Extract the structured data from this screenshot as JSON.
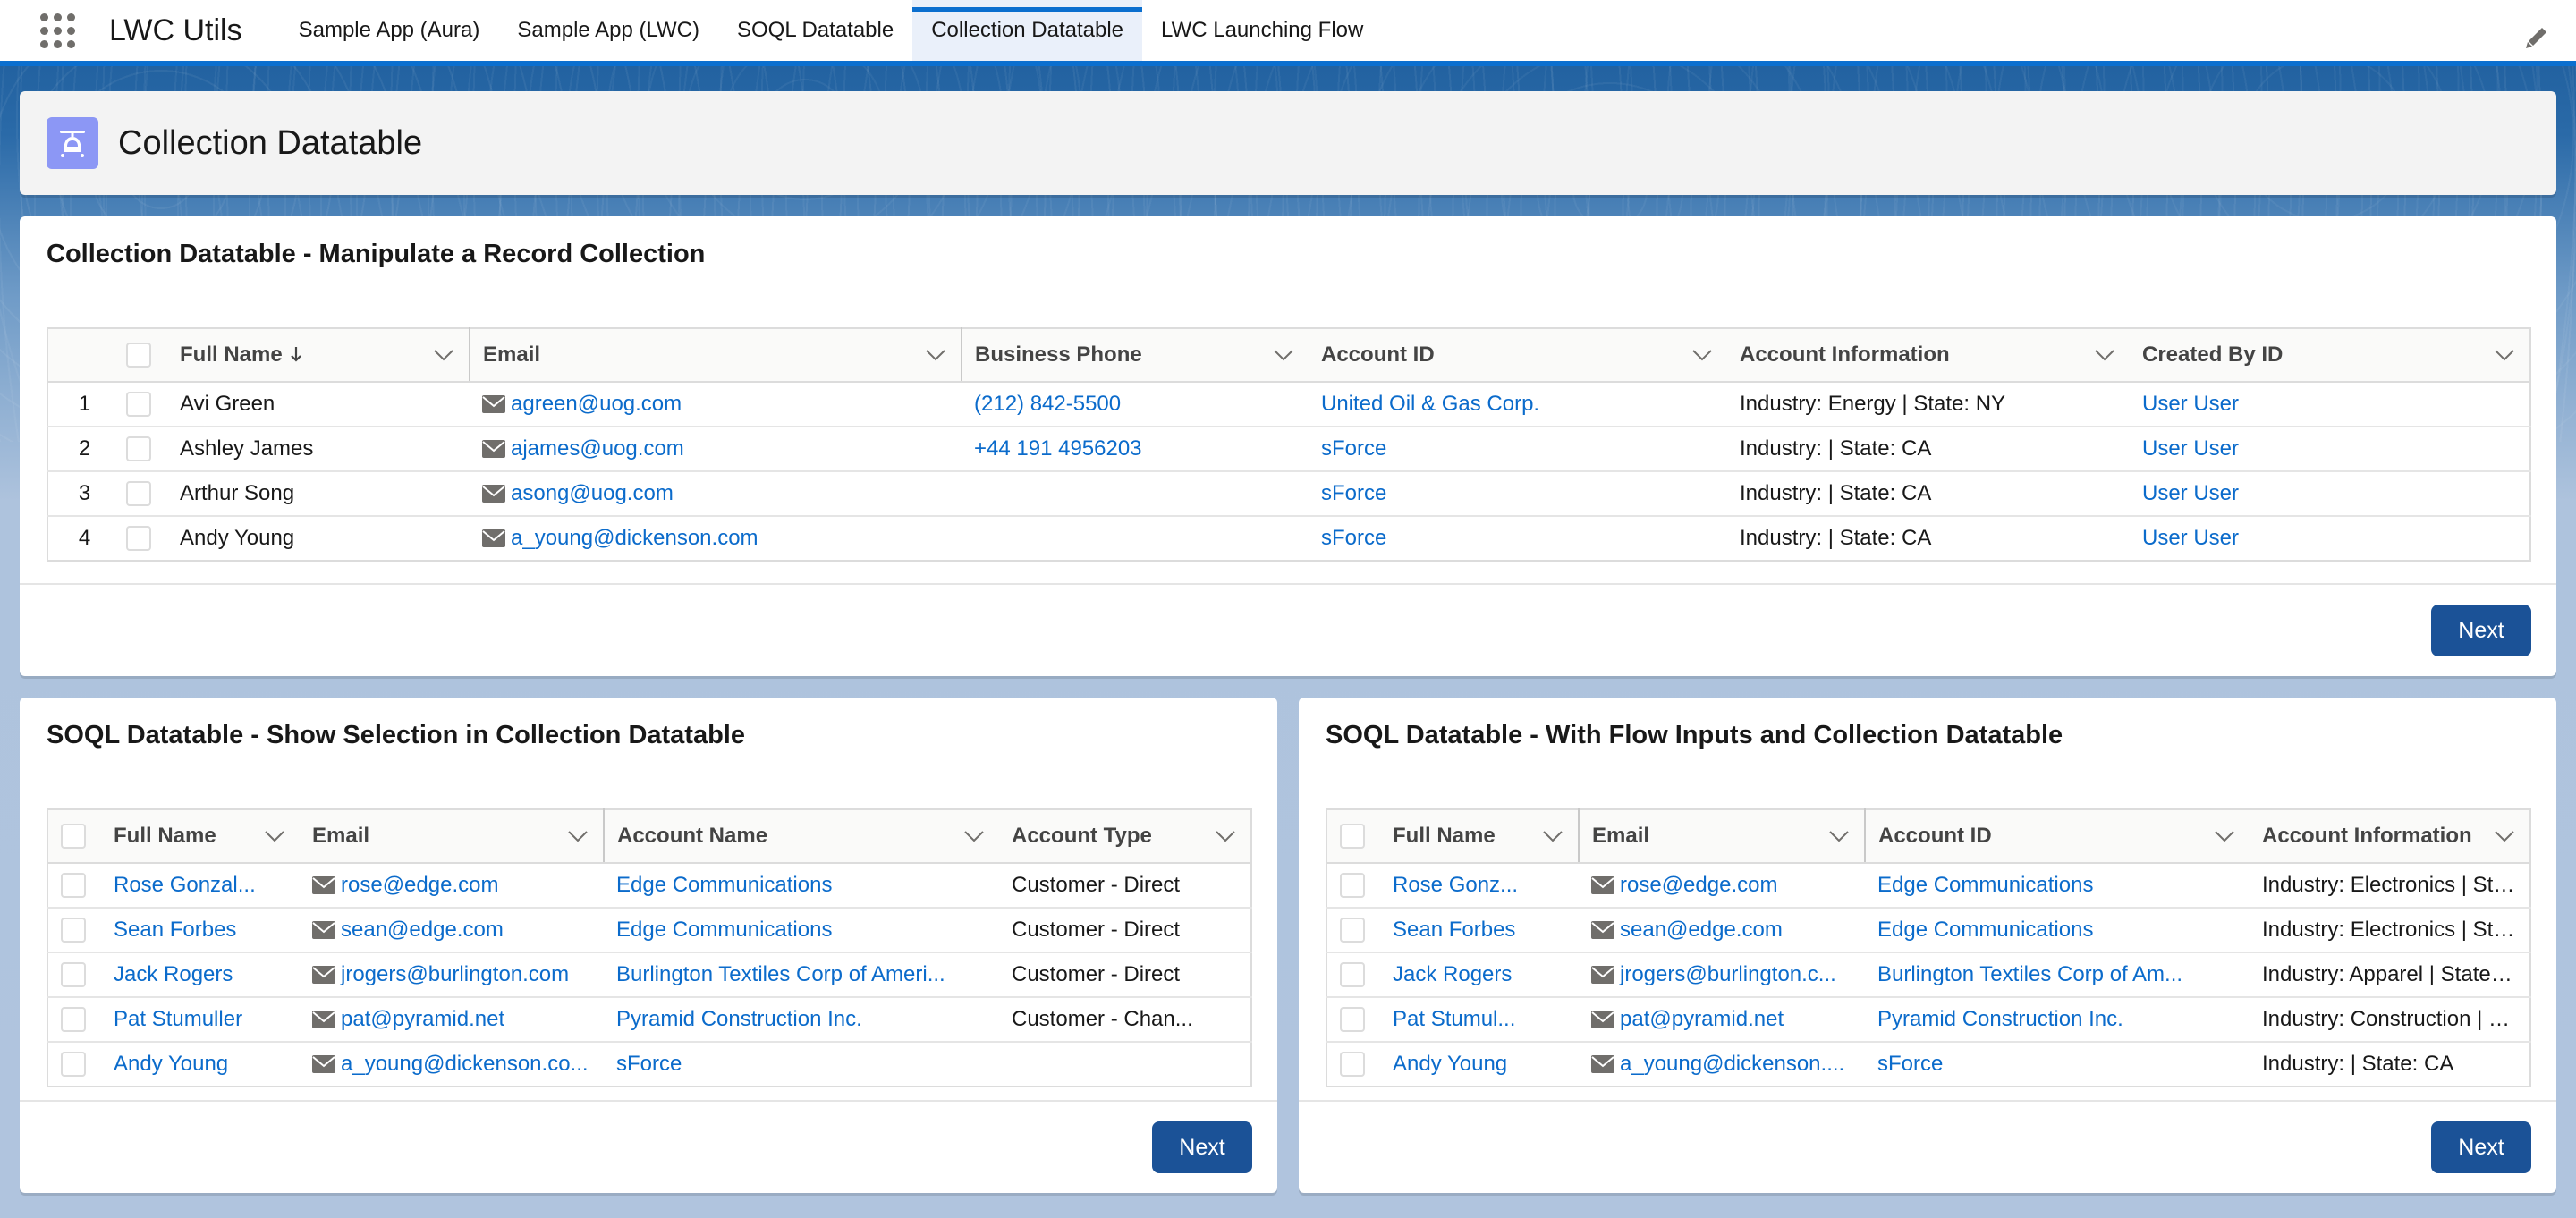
{
  "nav": {
    "app_name": "LWC Utils",
    "tabs": [
      {
        "label": "Sample App (Aura)",
        "active": false
      },
      {
        "label": "Sample App (LWC)",
        "active": false
      },
      {
        "label": "SOQL Datatable",
        "active": false
      },
      {
        "label": "Collection Datatable",
        "active": true
      },
      {
        "label": "LWC Launching Flow",
        "active": false
      }
    ],
    "icons": {
      "launcher": "app-launcher-icon",
      "edit": "pencil-icon"
    }
  },
  "page_header": {
    "title": "Collection Datatable",
    "icon": "helicopter-icon",
    "icon_color": "#8c97f5"
  },
  "colors": {
    "brand": "#0b6fcf",
    "link": "#0b6bcb",
    "button": "#1b5297"
  },
  "card_main": {
    "title": "Collection Datatable - Manipulate a Record Collection",
    "columns": [
      "Full Name",
      "Email",
      "Business Phone",
      "Account ID",
      "Account Information",
      "Created By ID"
    ],
    "sorted_column": "Full Name",
    "sort_direction": "descending-arrow",
    "rows": [
      {
        "num": "1",
        "name": "Avi Green",
        "email": "agreen@uog.com",
        "phone": "(212) 842-5500",
        "account": "United Oil & Gas Corp.",
        "info": "Industry: Energy | State: NY",
        "created_by": "User User"
      },
      {
        "num": "2",
        "name": "Ashley James",
        "email": "ajames@uog.com",
        "phone": "+44 191 4956203",
        "account": "sForce",
        "info": "Industry: | State: CA",
        "created_by": "User User"
      },
      {
        "num": "3",
        "name": "Arthur Song",
        "email": "asong@uog.com",
        "phone": "",
        "account": "sForce",
        "info": "Industry: | State: CA",
        "created_by": "User User"
      },
      {
        "num": "4",
        "name": "Andy Young",
        "email": "a_young@dickenson.com",
        "phone": "",
        "account": "sForce",
        "info": "Industry: | State: CA",
        "created_by": "User User"
      }
    ],
    "next_label": "Next"
  },
  "card_left": {
    "title": "SOQL Datatable - Show Selection in Collection Datatable",
    "columns": [
      "Full Name",
      "Email",
      "Account Name",
      "Account Type"
    ],
    "rows": [
      {
        "name": "Rose Gonzal...",
        "email": "rose@edge.com",
        "account": "Edge Communications",
        "type": "Customer - Direct"
      },
      {
        "name": "Sean Forbes",
        "email": "sean@edge.com",
        "account": "Edge Communications",
        "type": "Customer - Direct"
      },
      {
        "name": "Jack Rogers",
        "email": "jrogers@burlington.com",
        "account": "Burlington Textiles Corp of Ameri...",
        "type": "Customer - Direct"
      },
      {
        "name": "Pat Stumuller",
        "email": "pat@pyramid.net",
        "account": "Pyramid Construction Inc.",
        "type": "Customer - Chan..."
      },
      {
        "name": "Andy Young",
        "email": "a_young@dickenson.co...",
        "account": "sForce",
        "type": ""
      }
    ],
    "next_label": "Next"
  },
  "card_right": {
    "title": "SOQL Datatable - With Flow Inputs and Collection Datatable",
    "columns": [
      "Full Name",
      "Email",
      "Account ID",
      "Account Information"
    ],
    "rows": [
      {
        "name": "Rose Gonz...",
        "email": "rose@edge.com",
        "account": "Edge Communications",
        "info": "Industry: Electronics | Stat..."
      },
      {
        "name": "Sean Forbes",
        "email": "sean@edge.com",
        "account": "Edge Communications",
        "info": "Industry: Electronics | Stat..."
      },
      {
        "name": "Jack Rogers",
        "email": "jrogers@burlington.c...",
        "account": "Burlington Textiles Corp of Am...",
        "info": "Industry: Apparel | State: NC"
      },
      {
        "name": "Pat Stumul...",
        "email": "pat@pyramid.net",
        "account": "Pyramid Construction Inc.",
        "info": "Industry: Construction | St..."
      },
      {
        "name": "Andy Young",
        "email": "a_young@dickenson....",
        "account": "sForce",
        "info": "Industry: | State: CA"
      }
    ],
    "next_label": "Next"
  }
}
